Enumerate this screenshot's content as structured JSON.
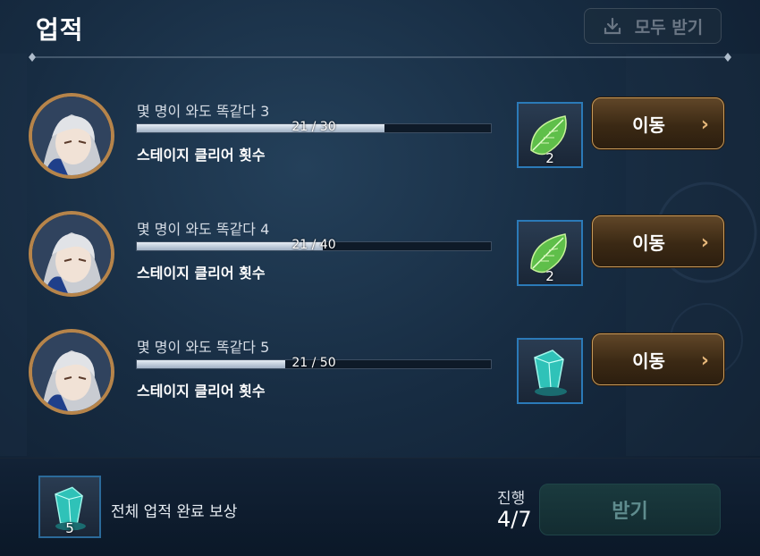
{
  "header": {
    "title": "업적",
    "claim_all_label": "모두 받기"
  },
  "achievements": [
    {
      "name": "몇 명이 와도 똑같다 3",
      "progress_text": "21 / 30",
      "progress_fraction": 0.7,
      "description": "스테이지 클리어 횟수",
      "reward_icon": "leaf-icon",
      "reward_count": "2",
      "button_label": "이동"
    },
    {
      "name": "몇 명이 와도 똑같다 4",
      "progress_text": "21 / 40",
      "progress_fraction": 0.525,
      "description": "스테이지 클리어 횟수",
      "reward_icon": "leaf-icon",
      "reward_count": "2",
      "button_label": "이동"
    },
    {
      "name": "몇 명이 와도 똑같다 5",
      "progress_text": "21 / 50",
      "progress_fraction": 0.42,
      "description": "스테이지 클리어 횟수",
      "reward_icon": "crystal-icon",
      "reward_count": "",
      "button_label": "이동"
    }
  ],
  "footer": {
    "total_reward_label": "전체 업적 완료 보상",
    "total_reward_icon": "crystal-icon",
    "total_reward_count": "5",
    "progress_label": "진행",
    "progress_value": "4/7",
    "claim_label": "받기"
  },
  "colors": {
    "accent_gold": "#c79a5a",
    "bar_fill": "#e6edf5",
    "background": "#172c42"
  }
}
